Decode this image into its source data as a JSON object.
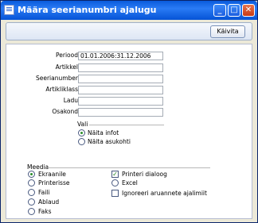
{
  "window": {
    "title": "Määra seerianumbri ajalugu",
    "minimize": "_",
    "maximize": "□",
    "close": "✕"
  },
  "toolbar": {
    "run_label": "Käivita"
  },
  "form": {
    "fields": [
      {
        "label": "Periood",
        "value": "01.01.2006:31.12.2006"
      },
      {
        "label": "Artikkel",
        "value": ""
      },
      {
        "label": "Seerianumber",
        "value": ""
      },
      {
        "label": "Artikliklass",
        "value": ""
      },
      {
        "label": "Ladu",
        "value": ""
      },
      {
        "label": "Osakond",
        "value": ""
      }
    ],
    "vali": {
      "title": "Vali",
      "options": [
        "Näita infot",
        "Näita asukohti"
      ],
      "selected": 0
    },
    "meedia": {
      "title": "Meedia",
      "options": [
        "Ekraanile",
        "Printerisse",
        "Faili",
        "Ablaud",
        "Faks"
      ],
      "selected": 0
    },
    "checks": [
      {
        "label": "Printeri dialoog",
        "checked": true
      },
      {
        "label": "Excel",
        "checked": false,
        "radio": true
      },
      {
        "label": "Ignoreeri aruannete ajalimiit",
        "checked": false
      }
    ]
  }
}
